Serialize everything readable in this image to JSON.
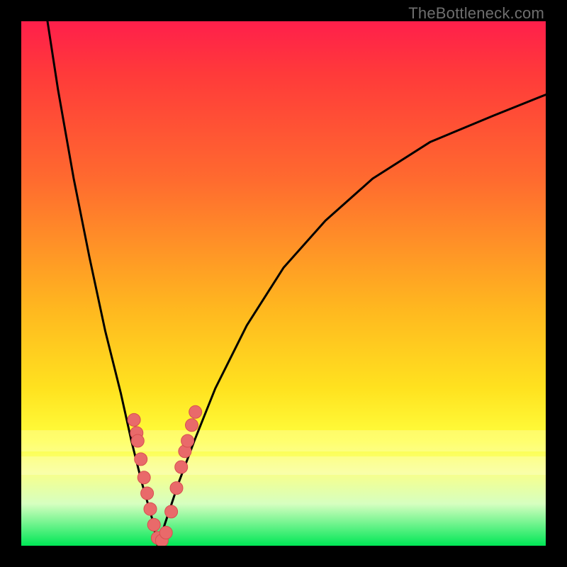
{
  "watermark": "TheBottleneck.com",
  "colors": {
    "frame": "#000000",
    "gradient_top": "#ff1f4b",
    "gradient_bottom": "#00e756",
    "curve": "#000000",
    "markers": "#e96a6a",
    "marker_stroke": "#d74f50"
  },
  "chart_data": {
    "type": "line",
    "title": "",
    "xlabel": "",
    "ylabel": "",
    "xlim": [
      0,
      100
    ],
    "ylim": [
      0,
      100
    ],
    "grid": false,
    "legend": false,
    "series": [
      {
        "name": "left-branch",
        "x": [
          5,
          7,
          10,
          13,
          16,
          19,
          21,
          23,
          25,
          26
        ],
        "y": [
          100,
          87,
          70,
          55,
          41,
          29,
          20,
          12,
          5,
          0
        ]
      },
      {
        "name": "right-branch",
        "x": [
          26,
          28,
          30,
          33,
          37,
          43,
          50,
          58,
          67,
          78,
          90,
          100
        ],
        "y": [
          0,
          6,
          12,
          20,
          30,
          42,
          53,
          62,
          70,
          77,
          82,
          86
        ]
      }
    ],
    "markers": [
      {
        "x": 21.5,
        "y": 24.0
      },
      {
        "x": 22.0,
        "y": 21.5
      },
      {
        "x": 22.2,
        "y": 20.0
      },
      {
        "x": 22.8,
        "y": 16.5
      },
      {
        "x": 23.4,
        "y": 13.0
      },
      {
        "x": 24.0,
        "y": 10.0
      },
      {
        "x": 24.6,
        "y": 7.0
      },
      {
        "x": 25.3,
        "y": 4.0
      },
      {
        "x": 26.0,
        "y": 1.5
      },
      {
        "x": 26.8,
        "y": 1.0
      },
      {
        "x": 27.6,
        "y": 2.5
      },
      {
        "x": 28.6,
        "y": 6.5
      },
      {
        "x": 29.6,
        "y": 11.0
      },
      {
        "x": 30.5,
        "y": 15.0
      },
      {
        "x": 31.2,
        "y": 18.0
      },
      {
        "x": 31.7,
        "y": 20.0
      },
      {
        "x": 32.5,
        "y": 23.0
      },
      {
        "x": 33.2,
        "y": 25.5
      }
    ]
  }
}
